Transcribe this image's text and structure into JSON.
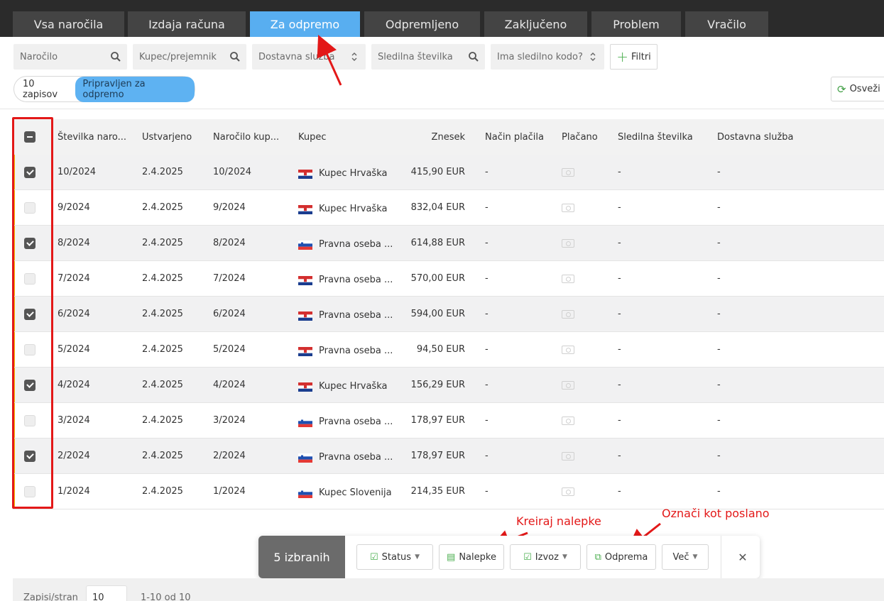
{
  "tabs": [
    {
      "label": "Vsa naročila",
      "active": false
    },
    {
      "label": "Izdaja računa",
      "active": false
    },
    {
      "label": "Za odpremo",
      "active": true
    },
    {
      "label": "Odpremljeno",
      "active": false
    },
    {
      "label": "Zaključeno",
      "active": false
    },
    {
      "label": "Problem",
      "active": false
    },
    {
      "label": "Vračilo",
      "active": false
    }
  ],
  "filters": {
    "order_placeholder": "Naročilo",
    "customer_placeholder": "Kupec/prejemnik",
    "delivery_placeholder": "Dostavna služba",
    "tracking_placeholder": "Sledilna številka",
    "has_tracking_placeholder": "Ima sledilno kodo?",
    "filters_button": "Filtri"
  },
  "records": {
    "count_label": "10 zapisov",
    "status_chip": "Pripravljen za odpremo",
    "refresh_label": "Osveži"
  },
  "table": {
    "headers": {
      "number": "Številka naro...",
      "created": "Ustvarjeno",
      "customer_order": "Naročilo kup...",
      "customer": "Kupec",
      "amount": "Znesek",
      "payment": "Način plačila",
      "paid": "Plačano",
      "tracking": "Sledilna številka",
      "delivery": "Dostavna služba"
    },
    "rows": [
      {
        "number": "10/2024",
        "created": "2.4.2025",
        "customer_order": "10/2024",
        "flag": "hr",
        "customer": "Kupec Hrvaška",
        "amount": "415,90 EUR",
        "payment": "-",
        "tracking": "-",
        "delivery": "-",
        "checked": true
      },
      {
        "number": "9/2024",
        "created": "2.4.2025",
        "customer_order": "9/2024",
        "flag": "hr",
        "customer": "Kupec Hrvaška",
        "amount": "832,04 EUR",
        "payment": "-",
        "tracking": "-",
        "delivery": "-",
        "checked": false
      },
      {
        "number": "8/2024",
        "created": "2.4.2025",
        "customer_order": "8/2024",
        "flag": "si",
        "customer": "Pravna oseba ...",
        "amount": "614,88 EUR",
        "payment": "-",
        "tracking": "-",
        "delivery": "-",
        "checked": true
      },
      {
        "number": "7/2024",
        "created": "2.4.2025",
        "customer_order": "7/2024",
        "flag": "hr",
        "customer": "Pravna oseba ...",
        "amount": "570,00 EUR",
        "payment": "-",
        "tracking": "-",
        "delivery": "-",
        "checked": false
      },
      {
        "number": "6/2024",
        "created": "2.4.2025",
        "customer_order": "6/2024",
        "flag": "hr",
        "customer": "Pravna oseba ...",
        "amount": "594,00 EUR",
        "payment": "-",
        "tracking": "-",
        "delivery": "-",
        "checked": true
      },
      {
        "number": "5/2024",
        "created": "2.4.2025",
        "customer_order": "5/2024",
        "flag": "hr",
        "customer": "Pravna oseba ...",
        "amount": "94,50 EUR",
        "payment": "-",
        "tracking": "-",
        "delivery": "-",
        "checked": false
      },
      {
        "number": "4/2024",
        "created": "2.4.2025",
        "customer_order": "4/2024",
        "flag": "hr",
        "customer": "Kupec Hrvaška",
        "amount": "156,29 EUR",
        "payment": "-",
        "tracking": "-",
        "delivery": "-",
        "checked": true
      },
      {
        "number": "3/2024",
        "created": "2.4.2025",
        "customer_order": "3/2024",
        "flag": "si",
        "customer": "Pravna oseba ...",
        "amount": "178,97 EUR",
        "payment": "-",
        "tracking": "-",
        "delivery": "-",
        "checked": false
      },
      {
        "number": "2/2024",
        "created": "2.4.2025",
        "customer_order": "2/2024",
        "flag": "si",
        "customer": "Pravna oseba ...",
        "amount": "178,97 EUR",
        "payment": "-",
        "tracking": "-",
        "delivery": "-",
        "checked": true
      },
      {
        "number": "1/2024",
        "created": "2.4.2025",
        "customer_order": "1/2024",
        "flag": "si",
        "customer": "Kupec Slovenija",
        "amount": "214,35 EUR",
        "payment": "-",
        "tracking": "-",
        "delivery": "-",
        "checked": false
      }
    ]
  },
  "actionbar": {
    "selected_label": "5 izbranih",
    "status": "Status",
    "labels": "Nalepke",
    "export": "Izvoz",
    "ship": "Odprema",
    "more": "Več"
  },
  "annotations": {
    "labels_note": "Kreiraj nalepke",
    "ship_note": "Označi kot poslano"
  },
  "footer": {
    "per_page_label": "Zapisi/stran",
    "per_page_value": "10",
    "range": "1-10 od 10"
  },
  "colors": {
    "tab_active": "#58aef0",
    "accent_green": "#4caf50",
    "annotation_red": "#e31818",
    "row_marker": "#f2c200"
  }
}
